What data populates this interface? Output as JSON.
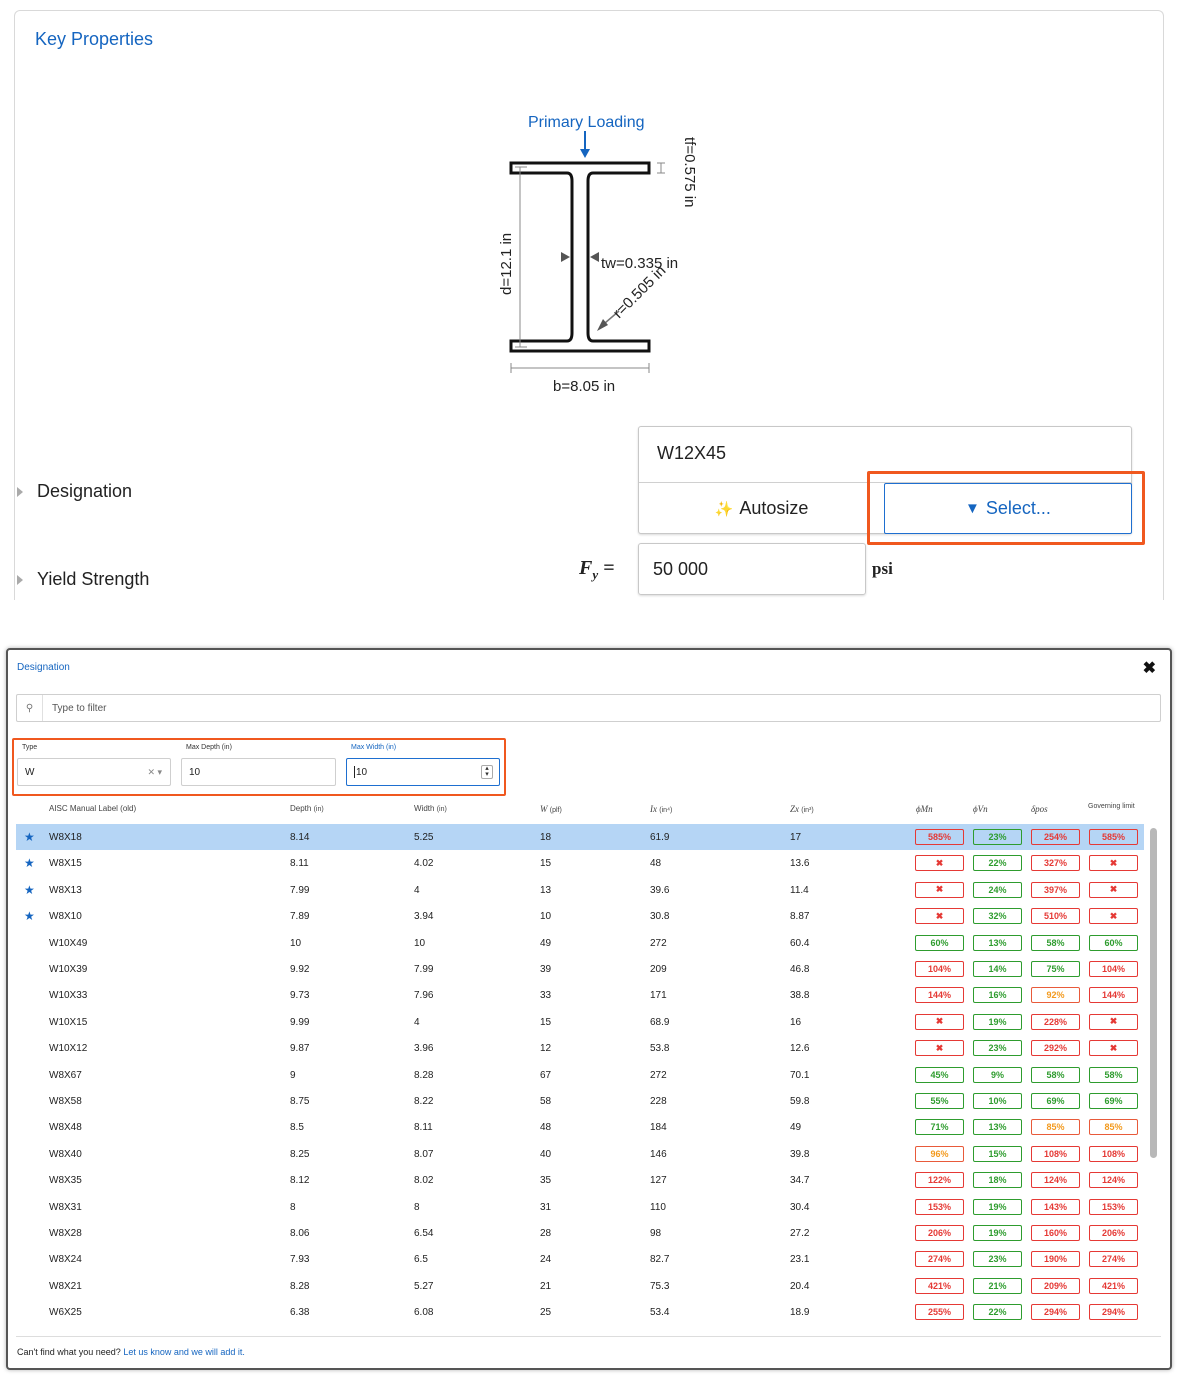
{
  "key_properties": {
    "title": "Key Properties",
    "diagram": {
      "primary_loading": "Primary Loading",
      "tf": "tf=0.575 in",
      "tw": "tw=0.335 in",
      "d": "d=12.1 in",
      "r": "r=0.505 in",
      "b": "b=8.05 in"
    },
    "designation": {
      "label": "Designation",
      "value": "W12X45",
      "autosize_label": "Autosize",
      "select_label": "Select..."
    },
    "yield_strength": {
      "label": "Yield Strength",
      "value": "50 000",
      "unit": "psi"
    }
  },
  "modal": {
    "title": "Designation",
    "filter_placeholder": "Type to filter",
    "filters": {
      "type_label": "Type",
      "type_value": "W",
      "max_depth_label": "Max Depth (in)",
      "max_depth_value": "10",
      "max_width_label": "Max Width (in)",
      "max_width_value": "10"
    },
    "columns": [
      "AISC Manual Label (old)",
      "Depth",
      "Width",
      "W",
      "Ix",
      "Zx",
      "ϕMn",
      "ϕVn",
      "δpos",
      "Governing limit"
    ],
    "column_units": [
      "",
      "(in)",
      "(in)",
      "(plf)",
      "(in⁴)",
      "(in³)",
      "",
      "",
      "",
      ""
    ],
    "rows": [
      {
        "label": "W8X18",
        "depth": "8.14",
        "width": "5.25",
        "w": "18",
        "ix": "61.9",
        "zx": "17",
        "mn": "585%",
        "vn": "23%",
        "dp": "254%",
        "gov": "585%",
        "star": "★"
      },
      {
        "label": "W8X15",
        "depth": "8.11",
        "width": "4.02",
        "w": "15",
        "ix": "48",
        "zx": "13.6",
        "mn": "✖",
        "vn": "22%",
        "dp": "327%",
        "gov": "✖",
        "star": "★"
      },
      {
        "label": "W8X13",
        "depth": "7.99",
        "width": "4",
        "w": "13",
        "ix": "39.6",
        "zx": "11.4",
        "mn": "✖",
        "vn": "24%",
        "dp": "397%",
        "gov": "✖",
        "star": "★"
      },
      {
        "label": "W8X10",
        "depth": "7.89",
        "width": "3.94",
        "w": "10",
        "ix": "30.8",
        "zx": "8.87",
        "mn": "✖",
        "vn": "32%",
        "dp": "510%",
        "gov": "✖",
        "star": "★"
      },
      {
        "label": "W10X49",
        "depth": "10",
        "width": "10",
        "w": "49",
        "ix": "272",
        "zx": "60.4",
        "mn": "60%",
        "vn": "13%",
        "dp": "58%",
        "gov": "60%",
        "star": ""
      },
      {
        "label": "W10X39",
        "depth": "9.92",
        "width": "7.99",
        "w": "39",
        "ix": "209",
        "zx": "46.8",
        "mn": "104%",
        "vn": "14%",
        "dp": "75%",
        "gov": "104%",
        "star": ""
      },
      {
        "label": "W10X33",
        "depth": "9.73",
        "width": "7.96",
        "w": "33",
        "ix": "171",
        "zx": "38.8",
        "mn": "144%",
        "vn": "16%",
        "dp": "92%",
        "gov": "144%",
        "star": ""
      },
      {
        "label": "W10X15",
        "depth": "9.99",
        "width": "4",
        "w": "15",
        "ix": "68.9",
        "zx": "16",
        "mn": "✖",
        "vn": "19%",
        "dp": "228%",
        "gov": "✖",
        "star": ""
      },
      {
        "label": "W10X12",
        "depth": "9.87",
        "width": "3.96",
        "w": "12",
        "ix": "53.8",
        "zx": "12.6",
        "mn": "✖",
        "vn": "23%",
        "dp": "292%",
        "gov": "✖",
        "star": ""
      },
      {
        "label": "W8X67",
        "depth": "9",
        "width": "8.28",
        "w": "67",
        "ix": "272",
        "zx": "70.1",
        "mn": "45%",
        "vn": "9%",
        "dp": "58%",
        "gov": "58%",
        "star": ""
      },
      {
        "label": "W8X58",
        "depth": "8.75",
        "width": "8.22",
        "w": "58",
        "ix": "228",
        "zx": "59.8",
        "mn": "55%",
        "vn": "10%",
        "dp": "69%",
        "gov": "69%",
        "star": ""
      },
      {
        "label": "W8X48",
        "depth": "8.5",
        "width": "8.11",
        "w": "48",
        "ix": "184",
        "zx": "49",
        "mn": "71%",
        "vn": "13%",
        "dp": "85%",
        "gov": "85%",
        "star": ""
      },
      {
        "label": "W8X40",
        "depth": "8.25",
        "width": "8.07",
        "w": "40",
        "ix": "146",
        "zx": "39.8",
        "mn": "96%",
        "vn": "15%",
        "dp": "108%",
        "gov": "108%",
        "star": ""
      },
      {
        "label": "W8X35",
        "depth": "8.12",
        "width": "8.02",
        "w": "35",
        "ix": "127",
        "zx": "34.7",
        "mn": "122%",
        "vn": "18%",
        "dp": "124%",
        "gov": "124%",
        "star": ""
      },
      {
        "label": "W8X31",
        "depth": "8",
        "width": "8",
        "w": "31",
        "ix": "110",
        "zx": "30.4",
        "mn": "153%",
        "vn": "19%",
        "dp": "143%",
        "gov": "153%",
        "star": ""
      },
      {
        "label": "W8X28",
        "depth": "8.06",
        "width": "6.54",
        "w": "28",
        "ix": "98",
        "zx": "27.2",
        "mn": "206%",
        "vn": "19%",
        "dp": "160%",
        "gov": "206%",
        "star": ""
      },
      {
        "label": "W8X24",
        "depth": "7.93",
        "width": "6.5",
        "w": "24",
        "ix": "82.7",
        "zx": "23.1",
        "mn": "274%",
        "vn": "23%",
        "dp": "190%",
        "gov": "274%",
        "star": ""
      },
      {
        "label": "W8X21",
        "depth": "8.28",
        "width": "5.27",
        "w": "21",
        "ix": "75.3",
        "zx": "20.4",
        "mn": "421%",
        "vn": "21%",
        "dp": "209%",
        "gov": "421%",
        "star": ""
      },
      {
        "label": "W6X25",
        "depth": "6.38",
        "width": "6.08",
        "w": "25",
        "ix": "53.4",
        "zx": "18.9",
        "mn": "255%",
        "vn": "22%",
        "dp": "294%",
        "gov": "294%",
        "star": ""
      }
    ],
    "footer_text": "Can't find what you need?",
    "footer_link": "Let us know and we will add it."
  }
}
